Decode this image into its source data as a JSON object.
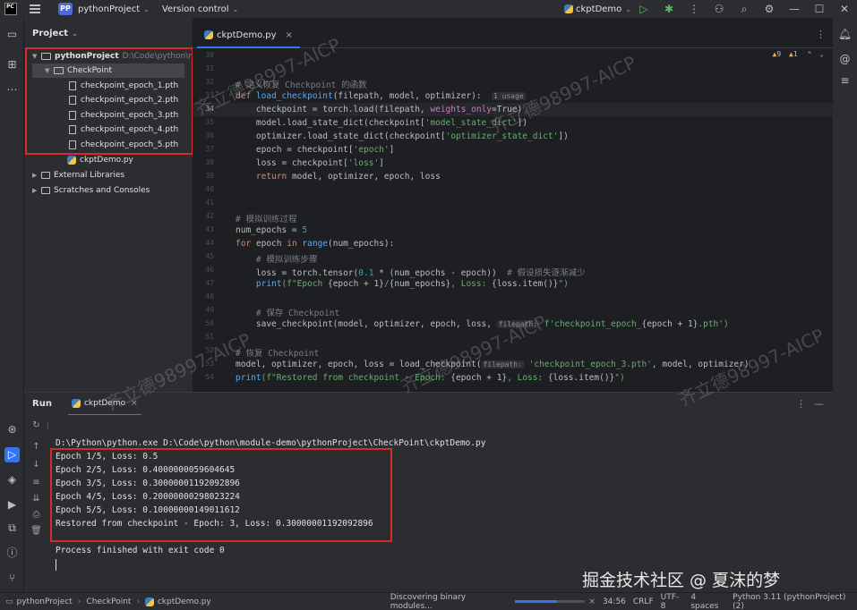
{
  "titlebar": {
    "logo": "PC",
    "project_badge": "PP",
    "project_name": "pythonProject",
    "vcs": "Version control",
    "run_config": "ckptDemo"
  },
  "project_panel": {
    "title": "Project",
    "root": "pythonProject",
    "root_path": "D:\\Code\\python\\mod",
    "folder": "CheckPoint",
    "files": [
      "checkpoint_epoch_1.pth",
      "checkpoint_epoch_2.pth",
      "checkpoint_epoch_3.pth",
      "checkpoint_epoch_4.pth",
      "checkpoint_epoch_5.pth"
    ],
    "script": "ckptDemo.py",
    "external": "External Libraries",
    "scratches": "Scratches and Consoles"
  },
  "editor": {
    "tab": "ckptDemo.py",
    "warnings": "9",
    "weak_warnings": "1",
    "line_numbers": [
      "30",
      "31",
      "32",
      "33",
      "34",
      "35",
      "36",
      "37",
      "38",
      "39",
      "40",
      "41",
      "42",
      "43",
      "44",
      "45",
      "46",
      "47",
      "48",
      "49",
      "50",
      "51",
      "52",
      "53",
      "54"
    ],
    "code": {
      "c32": "# 定义恢复 Checkpoint 的函数",
      "def": "def",
      "fname": "load_checkpoint",
      "args": "(filepath, model, optimizer):",
      "usage": "1 usage",
      "l34a": "checkpoint = torch.load(filepath,",
      "l34b": "weights_only",
      "l34c": "=True)",
      "l35a": "model.load_state_dict(checkpoint[",
      "l35b": "'model_state_dict'",
      "l35c": "])",
      "l36a": "optimizer.load_state_dict(checkpoint[",
      "l36b": "'optimizer_state_dict'",
      "l36c": "])",
      "l37a": "epoch = checkpoint[",
      "l37b": "'epoch'",
      "l37c": "]",
      "l38a": "loss = checkpoint[",
      "l38b": "'loss'",
      "l38c": "]",
      "l39kw": "return",
      "l39": " model, optimizer, epoch, loss",
      "c42": "# 模拟训练过程",
      "l43a": "num_epochs = ",
      "l43b": "5",
      "l44a": "for",
      "l44b": " epoch ",
      "l44c": "in",
      "l44d": " range",
      "l44e": "(num_epochs):",
      "c45": "# 模拟训练步骤",
      "l46a": "loss = torch.tensor(",
      "l46b": "0.1",
      "l46c": " * (num_epochs - epoch))",
      "l46d": "  # 假设损失逐渐减少",
      "l47a": "print",
      "l47b": "(f\"Epoch ",
      "l47c": "{epoch + 1}",
      "l47d": "/",
      "l47e": "{num_epochs}",
      "l47f": ", Loss: ",
      "l47g": "{loss.item()}",
      "l47h": "\")",
      "c49": "# 保存 Checkpoint",
      "l50a": "save_checkpoint(model, optimizer, epoch, loss, ",
      "l50hint": "filepath:",
      "l50b": " f'checkpoint_epoch_",
      "l50c": "{epoch + 1}",
      "l50d": ".pth')",
      "c52": "# 恢复 Checkpoint",
      "l53a": "model, optimizer, epoch, loss = load_checkpoint(",
      "l53hint": "filepath:",
      "l53b": " 'checkpoint_epoch_3.pth'",
      "l53c": ", model, optimizer)",
      "l54a": "print",
      "l54b": "(f\"Restored from checkpoint - Epoch: ",
      "l54c": "{epoch + 1}",
      "l54d": ", Loss: ",
      "l54e": "{loss.item()}",
      "l54f": "\")"
    }
  },
  "run": {
    "title": "Run",
    "tab": "ckptDemo",
    "command": "D:\\Python\\python.exe D:\\Code\\python\\module-demo\\pythonProject\\CheckPoint\\ckptDemo.py",
    "output": [
      "Epoch 1/5, Loss: 0.5",
      "Epoch 2/5, Loss: 0.4000000059604645",
      "Epoch 3/5, Loss: 0.30000001192092896",
      "Epoch 4/5, Loss: 0.20000000298023224",
      "Epoch 5/5, Loss: 0.10000000149011612",
      "Restored from checkpoint - Epoch: 3, Loss: 0.30000001192092896"
    ],
    "exit": "Process finished with exit code 0"
  },
  "statusbar": {
    "crumb1": "pythonProject",
    "crumb2": "CheckPoint",
    "crumb3": "ckptDemo.py",
    "task": "Discovering binary modules...",
    "progress": 0.6,
    "position": "34:56",
    "line_sep": "CRLF",
    "encoding": "UTF-8",
    "indent": "4 spaces",
    "interpreter": "Python 3.11 (pythonProject) (2)"
  },
  "watermarks": {
    "text": "齐立德98997-AICP",
    "footer": "掘金技术社区 @ 夏沫的梦"
  },
  "colors": {
    "accent": "#3574f0",
    "highlight_box": "#d92a2a"
  }
}
